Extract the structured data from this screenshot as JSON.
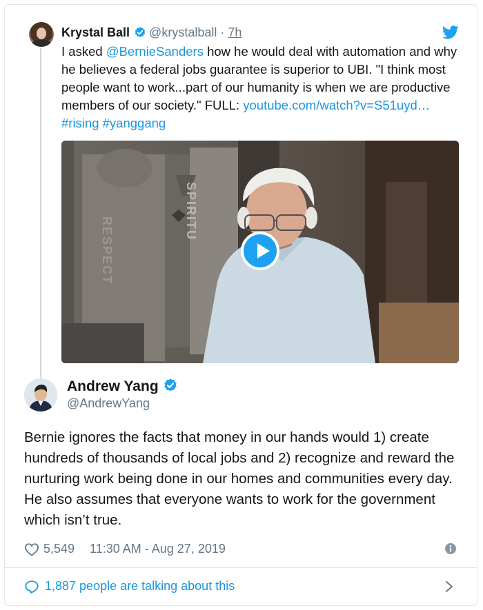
{
  "quoted_tweet": {
    "author_name": "Krystal Ball",
    "handle": "@krystalball",
    "separator": "·",
    "time": "7h",
    "text_plain_1": "I asked ",
    "mention": "@BernieSanders",
    "text_plain_2": " how he would deal with automation and why he believes a federal jobs guarantee is superior to UBI. \"I think most people want to work...part of our humanity is when we are productive members of our society.\" FULL: ",
    "url": "youtube.com/watch?v=S51uyd…",
    "hashtags": [
      "#rising",
      "#yanggang"
    ],
    "video_wall_text": [
      "SPIRITU",
      "RESPECT"
    ]
  },
  "main_tweet": {
    "author_name": "Andrew Yang",
    "handle": "@AndrewYang",
    "text": "Bernie ignores the facts that money in our hands would 1) create hundreds of thousands of local jobs and 2) recognize and reward the nurturing work being done in our homes and communities every day.  He also assumes that everyone wants to work for the government which isn’t true.",
    "likes": "5,549",
    "timestamp": "11:30 AM - Aug 27, 2019"
  },
  "footer": {
    "talking_text": "1,887 people are talking about this"
  },
  "icons": {
    "verified": "verified-badge-icon",
    "bird": "twitter-bird-icon",
    "play": "play-icon",
    "heart": "heart-icon",
    "info": "info-icon",
    "bubble": "speech-bubble-icon",
    "chevron": "chevron-right-icon"
  },
  "colors": {
    "accent": "#1da1f2",
    "link": "#1b95e0",
    "muted": "#657786",
    "text": "#14171a"
  }
}
